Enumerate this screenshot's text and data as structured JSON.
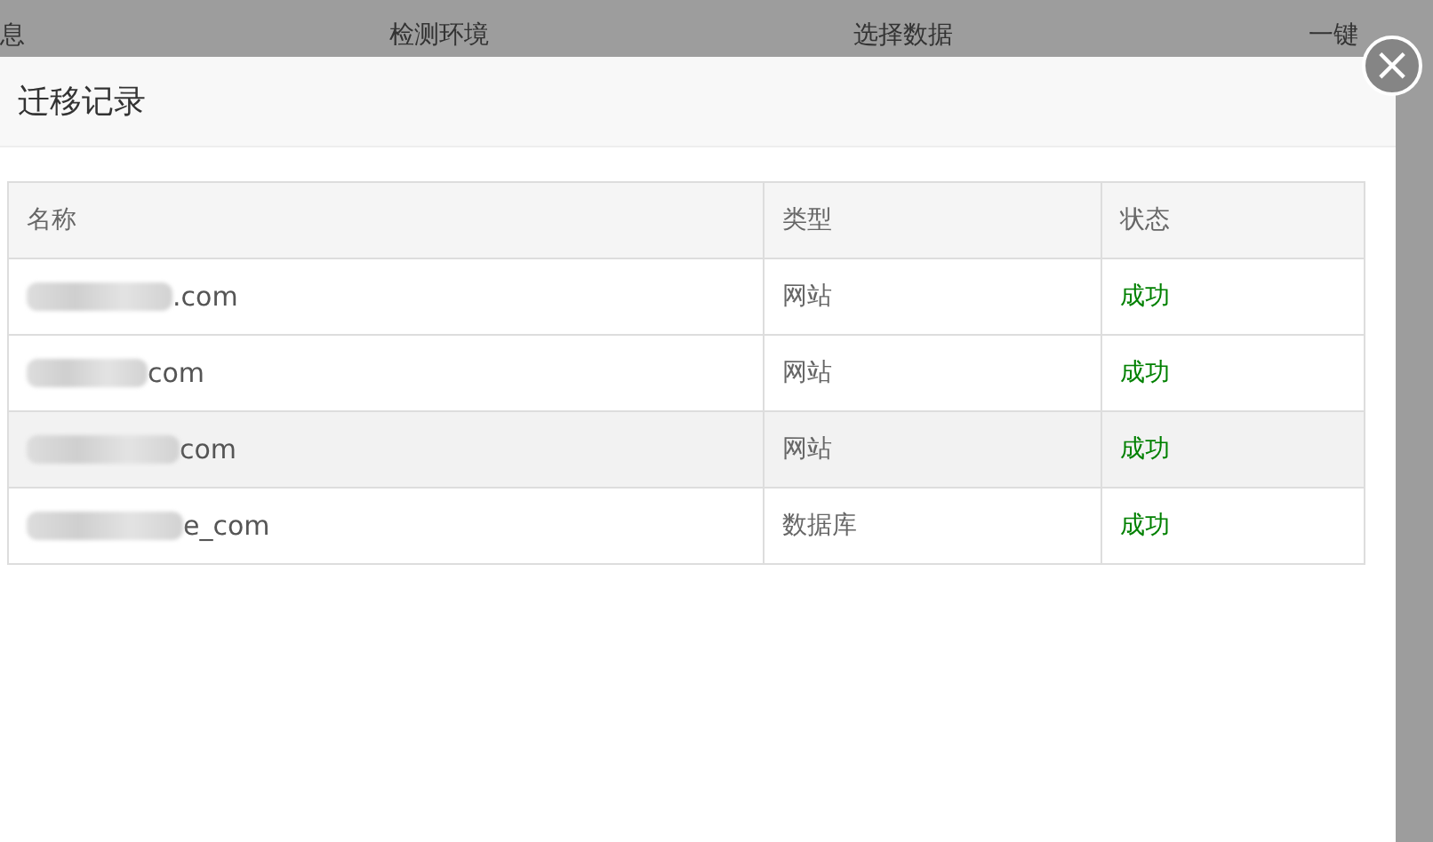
{
  "background_steps": [
    "息",
    "检测环境",
    "选择数据",
    "一键"
  ],
  "dialog": {
    "title": "迁移记录",
    "close_icon": "×"
  },
  "table": {
    "columns": [
      "名称",
      "类型",
      "状态"
    ],
    "rows": [
      {
        "name": ".com",
        "type": "网站",
        "status": "成功",
        "highlighted": false
      },
      {
        "name": "com",
        "type": "网站",
        "status": "成功",
        "highlighted": false
      },
      {
        "name": "com",
        "type": "网站",
        "status": "成功",
        "highlighted": true
      },
      {
        "name": "e_com",
        "type": "数据库",
        "status": "成功",
        "highlighted": false
      }
    ]
  }
}
